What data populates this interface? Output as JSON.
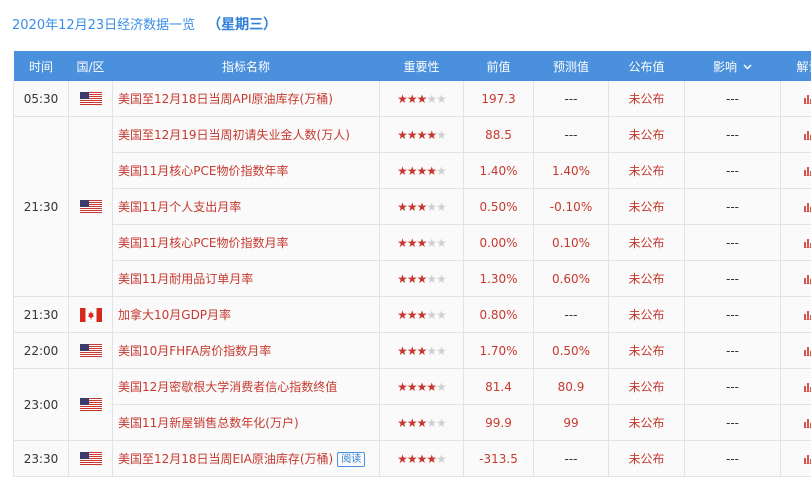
{
  "heading": {
    "date": "2020年12月23日经济数据一览",
    "weekday": "（星期三）"
  },
  "columns": {
    "time": "时间",
    "region": "国/区",
    "indicator": "指标名称",
    "importance": "重要性",
    "previous": "前值",
    "forecast": "预测值",
    "actual": "公布值",
    "impact": "影响",
    "interpretation": "解读"
  },
  "rows": [
    {
      "time": "05:30",
      "flag": "us-flag-icon",
      "indicator": "美国至12月18日当周API原油库存(万桶)",
      "stars": 3,
      "previous": "197.3",
      "forecast": "---",
      "actual": "未公布",
      "impact": "---"
    },
    {
      "time": "21:30",
      "flag": "us-flag-icon",
      "indicator": "美国至12月19日当周初请失业金人数(万人)",
      "stars": 4,
      "previous": "88.5",
      "forecast": "---",
      "actual": "未公布",
      "impact": "---"
    },
    {
      "time": "",
      "flag": "",
      "indicator": "美国11月核心PCE物价指数年率",
      "stars": 4,
      "previous": "1.40%",
      "forecast": "1.40%",
      "actual": "未公布",
      "impact": "---"
    },
    {
      "time": "",
      "flag": "",
      "indicator": "美国11月个人支出月率",
      "stars": 3,
      "previous": "0.50%",
      "forecast": "-0.10%",
      "actual": "未公布",
      "impact": "---"
    },
    {
      "time": "",
      "flag": "",
      "indicator": "美国11月核心PCE物价指数月率",
      "stars": 3,
      "previous": "0.00%",
      "forecast": "0.10%",
      "actual": "未公布",
      "impact": "---"
    },
    {
      "time": "",
      "flag": "",
      "indicator": "美国11月耐用品订单月率",
      "stars": 3,
      "previous": "1.30%",
      "forecast": "0.60%",
      "actual": "未公布",
      "impact": "---"
    },
    {
      "time": "21:30",
      "flag": "ca-flag-icon",
      "indicator": "加拿大10月GDP月率",
      "stars": 3,
      "previous": "0.80%",
      "forecast": "---",
      "actual": "未公布",
      "impact": "---"
    },
    {
      "time": "22:00",
      "flag": "us-flag-icon",
      "indicator": "美国10月FHFA房价指数月率",
      "stars": 3,
      "previous": "1.70%",
      "forecast": "0.50%",
      "actual": "未公布",
      "impact": "---"
    },
    {
      "time": "23:00",
      "flag": "us-flag-icon",
      "indicator": "美国12月密歇根大学消费者信心指数终值",
      "stars": 4,
      "previous": "81.4",
      "forecast": "80.9",
      "actual": "未公布",
      "impact": "---"
    },
    {
      "time": "",
      "flag": "",
      "indicator": "美国11月新屋销售总数年化(万户)",
      "stars": 3,
      "previous": "99.9",
      "forecast": "99",
      "actual": "未公布",
      "impact": "---"
    },
    {
      "time": "23:30",
      "flag": "us-flag-icon",
      "indicator": "美国至12月18日当周EIA原油库存(万桶)",
      "stars": 4,
      "previous": "-313.5",
      "forecast": "---",
      "actual": "未公布",
      "impact": "---",
      "read_label": "阅读"
    }
  ],
  "colors": {
    "header_bg": "#4a90dc",
    "accent_red": "#c6392f",
    "star_on": "#c8372d",
    "star_off": "#d0d0d0"
  }
}
